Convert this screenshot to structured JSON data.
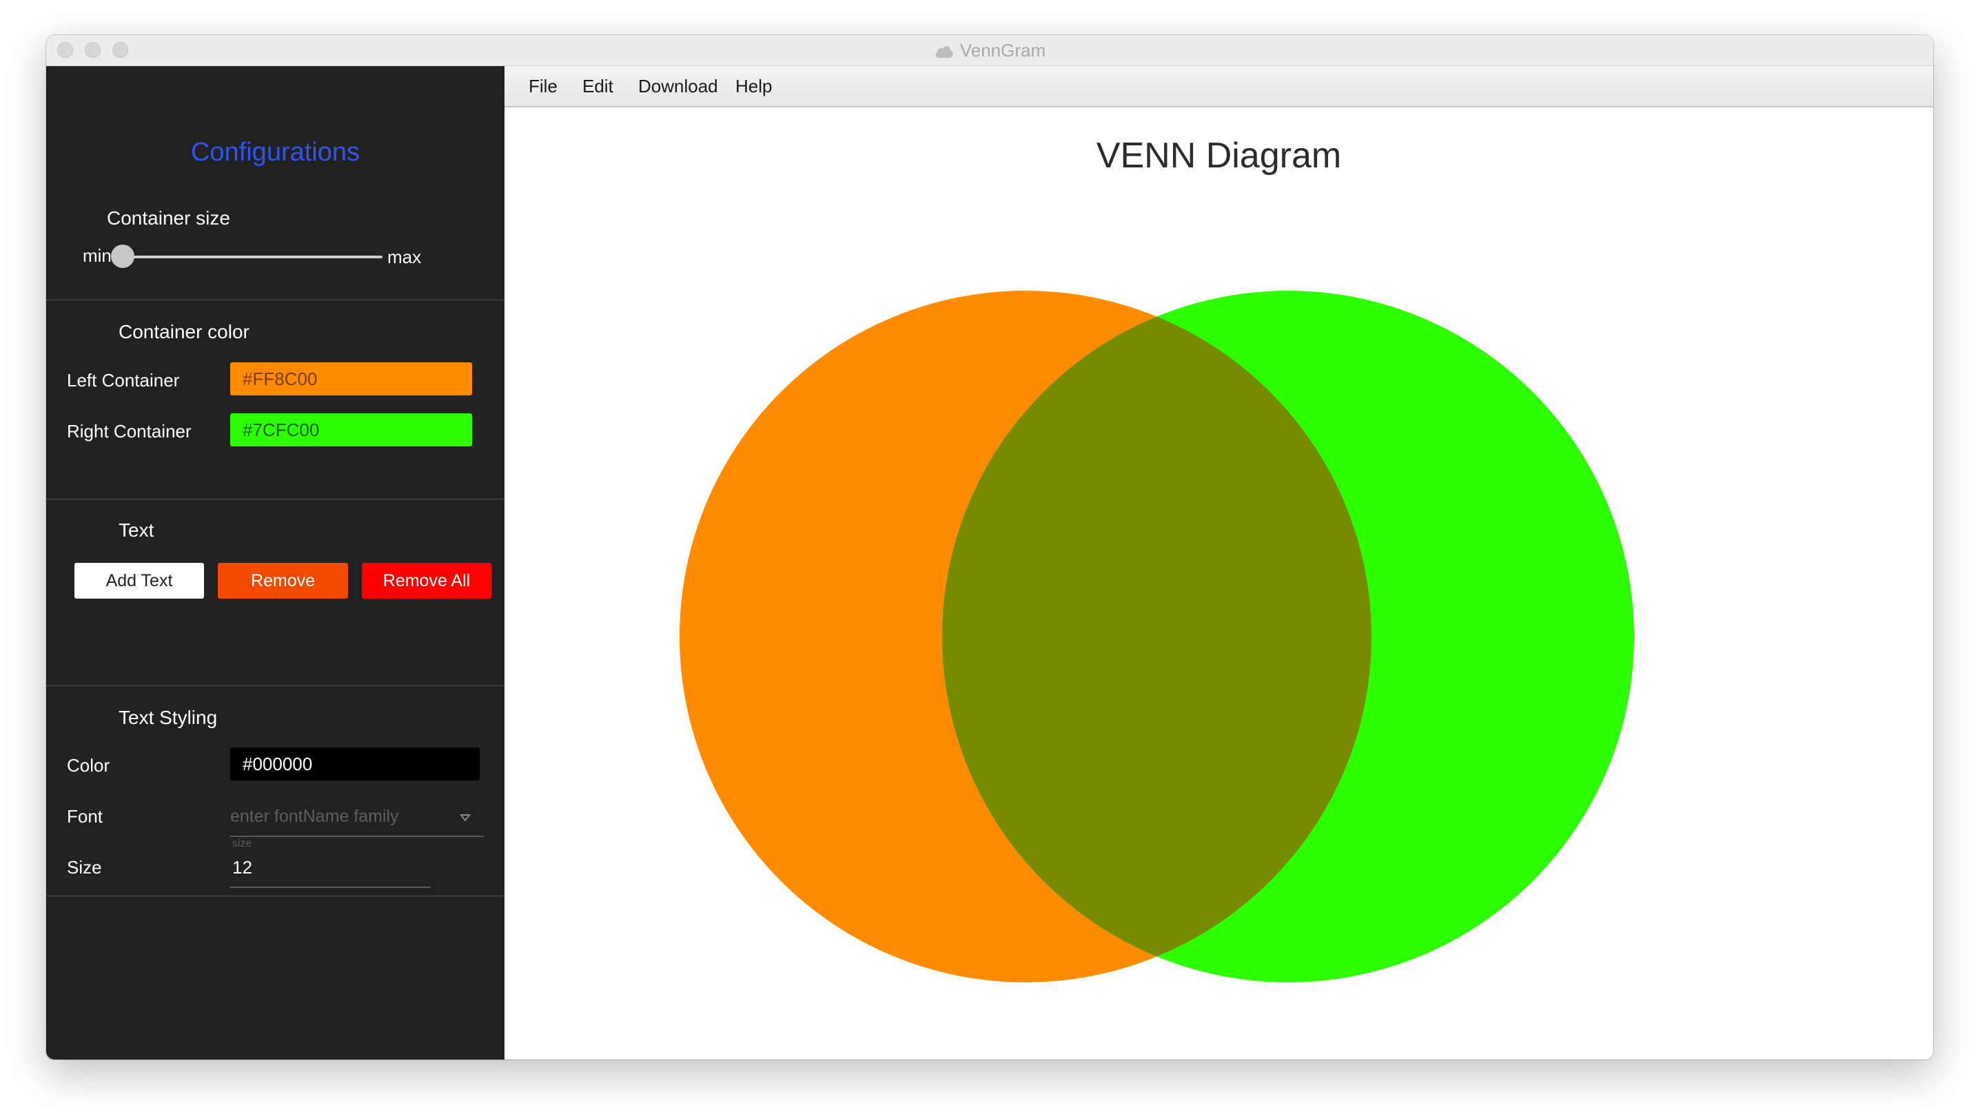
{
  "window": {
    "title": "VennGram",
    "icon": "cloud-icon"
  },
  "menu": [
    "File",
    "Edit",
    "Download",
    "Help"
  ],
  "sidebar": {
    "heading": "Configurations",
    "container_size": {
      "title": "Container size",
      "min_label": "min",
      "max_label": "max",
      "value": 0
    },
    "container_color": {
      "title": "Container color",
      "left_label": "Left Container",
      "left_value": "#FF8C00",
      "right_label": "Right Container",
      "right_value": "#7CFC00"
    },
    "text": {
      "title": "Text",
      "add": "Add Text",
      "remove": "Remove",
      "remove_all": "Remove All"
    },
    "text_styling": {
      "title": "Text Styling",
      "color_label": "Color",
      "color_value": "#000000",
      "font_label": "Font",
      "font_placeholder": "enter fontName family",
      "size_label": "Size",
      "size_hint": "size",
      "size_value": "12"
    }
  },
  "canvas": {
    "title": "VENN Diagram",
    "left_color": "#FF8C00",
    "right_color": "#2BFF00",
    "overlap_color": "#778B00"
  },
  "colors": {
    "sidebar_bg": "#212121",
    "heading": "#2F55F0",
    "remove_button": "#F24A00",
    "remove_all_button": "#FF0000"
  }
}
